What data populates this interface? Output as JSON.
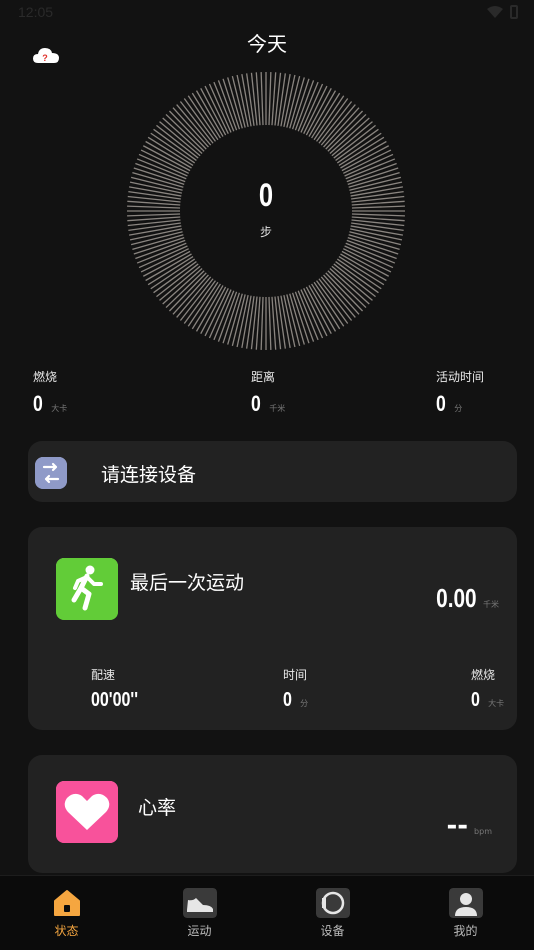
{
  "status_bar": {
    "time": "12:05"
  },
  "header": {
    "title": "今天"
  },
  "steps": {
    "value": "0",
    "unit": "步"
  },
  "summary": [
    {
      "label": "燃烧",
      "value": "0",
      "unit": "大卡"
    },
    {
      "label": "距离",
      "value": "0",
      "unit": "千米"
    },
    {
      "label": "活动时间",
      "value": "0",
      "unit": "分"
    }
  ],
  "connect_card": {
    "text": "请连接设备"
  },
  "last_workout": {
    "title": "最后一次运动",
    "distance": "0.00",
    "distance_unit": "千米",
    "stats": [
      {
        "label": "配速",
        "value": "00'00''",
        "unit": ""
      },
      {
        "label": "时间",
        "value": "0",
        "unit": "分"
      },
      {
        "label": "燃烧",
        "value": "0",
        "unit": "大卡"
      }
    ]
  },
  "heart_rate": {
    "title": "心率",
    "value": "--",
    "unit": "bpm"
  },
  "tabs": [
    {
      "label": "状态",
      "icon": "home-icon",
      "active": true
    },
    {
      "label": "运动",
      "icon": "shoe-icon",
      "active": false
    },
    {
      "label": "设备",
      "icon": "watch-icon",
      "active": false
    },
    {
      "label": "我的",
      "icon": "profile-icon",
      "active": false
    }
  ],
  "colors": {
    "background": "#121212",
    "card": "#222222",
    "accent": "#f5a640",
    "ring": "#8a8580",
    "runner_green": "#5cc936",
    "heart_pink": "#f8529b"
  }
}
